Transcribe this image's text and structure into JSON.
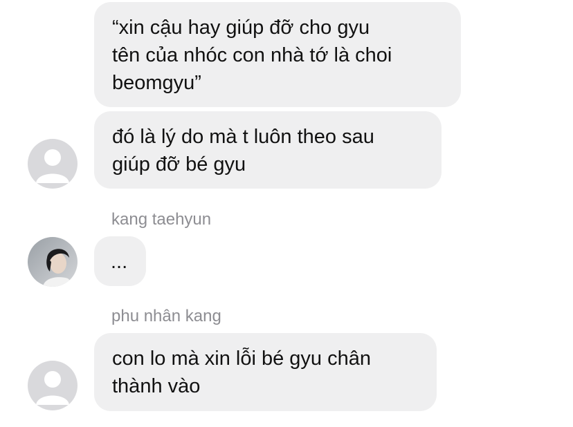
{
  "messages": [
    {
      "sender": "",
      "text": "“xin cậu hay giúp đỡ cho gyu\ntên của nhóc con nhà tớ là choi\nbeomgyu”",
      "avatar": "none"
    },
    {
      "sender": "",
      "text": "đó là lý do mà t luôn theo sau\ngiúp đỡ bé gyu",
      "avatar": "default-avatar-icon"
    },
    {
      "sender": "kang taehyun",
      "text": "...",
      "avatar": "profile-photo"
    },
    {
      "sender": "phu nhân kang",
      "text": "con lo mà xin lỗi bé gyu chân\nthành vào",
      "avatar": "default-avatar-icon"
    }
  ],
  "colors": {
    "bubble": "#efeff0",
    "sender_name": "#8d8d92",
    "default_avatar_bg": "#d9d9dc",
    "text": "#111111"
  }
}
